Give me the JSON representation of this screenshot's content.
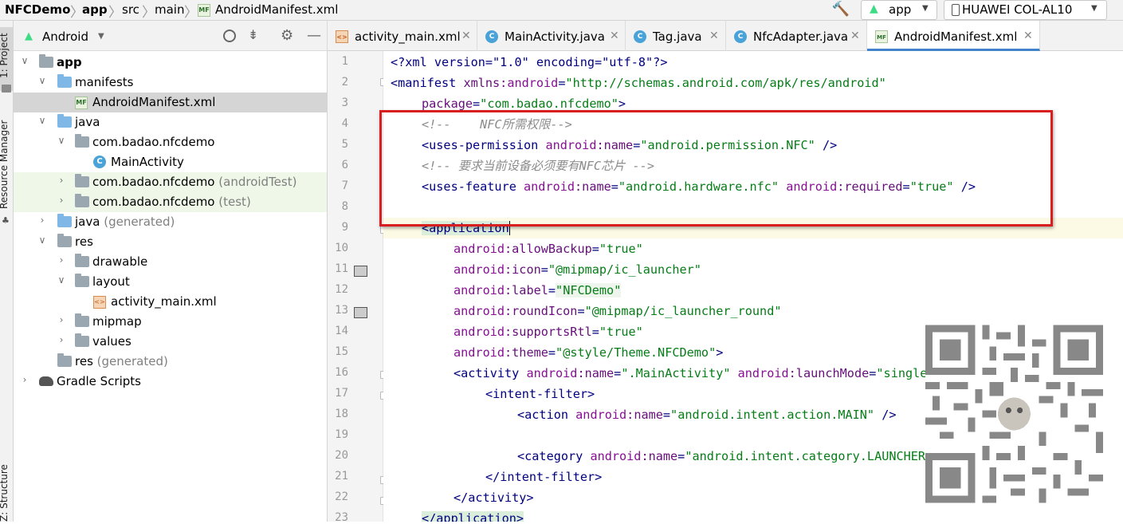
{
  "breadcrumb": {
    "project": "NFCDemo",
    "module": "app",
    "src": "src",
    "main": "main",
    "file": "AndroidManifest.xml",
    "file_icon": "MF"
  },
  "run": {
    "config": "app",
    "device": "HUAWEI COL-AL10"
  },
  "sidebar": {
    "project_tab": "1: Project",
    "resource_manager_tab": "Resource Manager",
    "structure_tab": "Z: Structure"
  },
  "project_panel": {
    "view": "Android"
  },
  "tree": {
    "app": "app",
    "manifests": "manifests",
    "manifest_file": "AndroidManifest.xml",
    "java": "java",
    "pkg": "com.badao.nfcdemo",
    "main_activity": "MainActivity",
    "pkg2": "com.badao.nfcdemo",
    "pkg2_suffix": "(androidTest)",
    "pkg3": "com.badao.nfcdemo",
    "pkg3_suffix": "(test)",
    "java_gen": "java",
    "java_gen_suffix": "(generated)",
    "res": "res",
    "drawable": "drawable",
    "layout": "layout",
    "activity_main": "activity_main.xml",
    "mipmap": "mipmap",
    "values": "values",
    "res_gen": "res",
    "res_gen_suffix": "(generated)",
    "gradle": "Gradle Scripts"
  },
  "tabs": [
    "activity_main.xml",
    "MainActivity.java",
    "Tag.java",
    "NfcAdapter.java",
    "AndroidManifest.xml"
  ],
  "line_numbers": [
    "1",
    "2",
    "3",
    "4",
    "5",
    "6",
    "7",
    "8",
    "9",
    "10",
    "11",
    "12",
    "13",
    "14",
    "15",
    "16",
    "17",
    "18",
    "19",
    "20",
    "21",
    "22",
    "23"
  ],
  "code": {
    "l1": [
      "<?xml version=\"1.0\" encoding=\"utf-8\"?>"
    ],
    "l2": [
      "<manifest ",
      "xmlns:",
      "android",
      "=",
      "\"http://schemas.android.com/apk/res/android\""
    ],
    "l3": [
      "package",
      "=",
      "\"com.badao.nfcdemo\"",
      ">"
    ],
    "l4": [
      "<!--    NFC所需权限-->"
    ],
    "l5": [
      "<uses-permission ",
      "android",
      ":name",
      "=",
      "\"android.permission.NFC\"",
      " />"
    ],
    "l6": [
      "<!-- 要求当前设备必须要有NFC芯片 -->"
    ],
    "l7": [
      "<uses-feature ",
      "android",
      ":name",
      "=",
      "\"android.hardware.nfc\"",
      " ",
      "android",
      ":required",
      "=",
      "\"true\"",
      " />"
    ],
    "l9": [
      "<application"
    ],
    "l10": [
      "android",
      ":allowBackup",
      "=",
      "\"true\""
    ],
    "l11": [
      "android",
      ":icon",
      "=",
      "\"@mipmap/ic_launcher\""
    ],
    "l12": [
      "android",
      ":label",
      "=",
      "\"NFCDemo\""
    ],
    "l13": [
      "android",
      ":roundIcon",
      "=",
      "\"@mipmap/ic_launcher_round\""
    ],
    "l14": [
      "android",
      ":supportsRtl",
      "=",
      "\"true\""
    ],
    "l15": [
      "android",
      ":theme",
      "=",
      "\"@style/Theme.NFCDemo\"",
      ">"
    ],
    "l16": [
      "<activity ",
      "android",
      ":name",
      "=",
      "\".MainActivity\"",
      " ",
      "android",
      ":launchMode",
      "=",
      "\"singleTop\"",
      ">"
    ],
    "l17": [
      "<intent-filter>"
    ],
    "l18": [
      "<action ",
      "android",
      ":name",
      "=",
      "\"android.intent.action.MAIN\"",
      " />"
    ],
    "l20": [
      "<category ",
      "android",
      ":name",
      "=",
      "\"android.intent.category.LAUNCHER\"",
      " />"
    ],
    "l21": [
      "</intent-filter>"
    ],
    "l22": [
      "</activity>"
    ],
    "l23": [
      "</application>"
    ]
  },
  "colors": {
    "annotation": "#d81e1e",
    "tag": "#000080",
    "attribute": "#660e7a",
    "value": "#067d17",
    "comment": "#8c8c8c"
  }
}
